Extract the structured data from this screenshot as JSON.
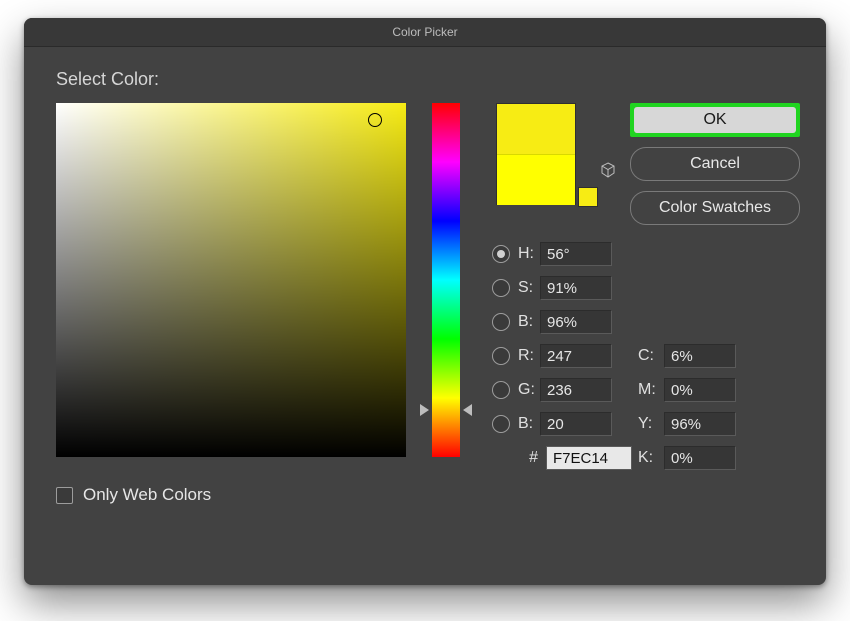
{
  "window": {
    "title": "Color Picker"
  },
  "labels": {
    "select_color": "Select Color:",
    "only_web_colors": "Only Web Colors",
    "hash": "#"
  },
  "buttons": {
    "ok": "OK",
    "cancel": "Cancel",
    "swatches": "Color Swatches"
  },
  "channels": {
    "h": {
      "label": "H:",
      "value": "56°"
    },
    "s": {
      "label": "S:",
      "value": "91%"
    },
    "b": {
      "label": "B:",
      "value": "96%"
    },
    "r": {
      "label": "R:",
      "value": "247"
    },
    "g": {
      "label": "G:",
      "value": "236"
    },
    "bch": {
      "label": "B:",
      "value": "20"
    }
  },
  "cmyk": {
    "c": {
      "label": "C:",
      "value": "6%"
    },
    "m": {
      "label": "M:",
      "value": "0%"
    },
    "y": {
      "label": "Y:",
      "value": "96%"
    },
    "k": {
      "label": "K:",
      "value": "0%"
    }
  },
  "hex": "F7EC14",
  "swatch_colors": {
    "new": "#f7ec14",
    "current": "#ffff00"
  },
  "radio_selected": "H",
  "only_web_colors_checked": false
}
